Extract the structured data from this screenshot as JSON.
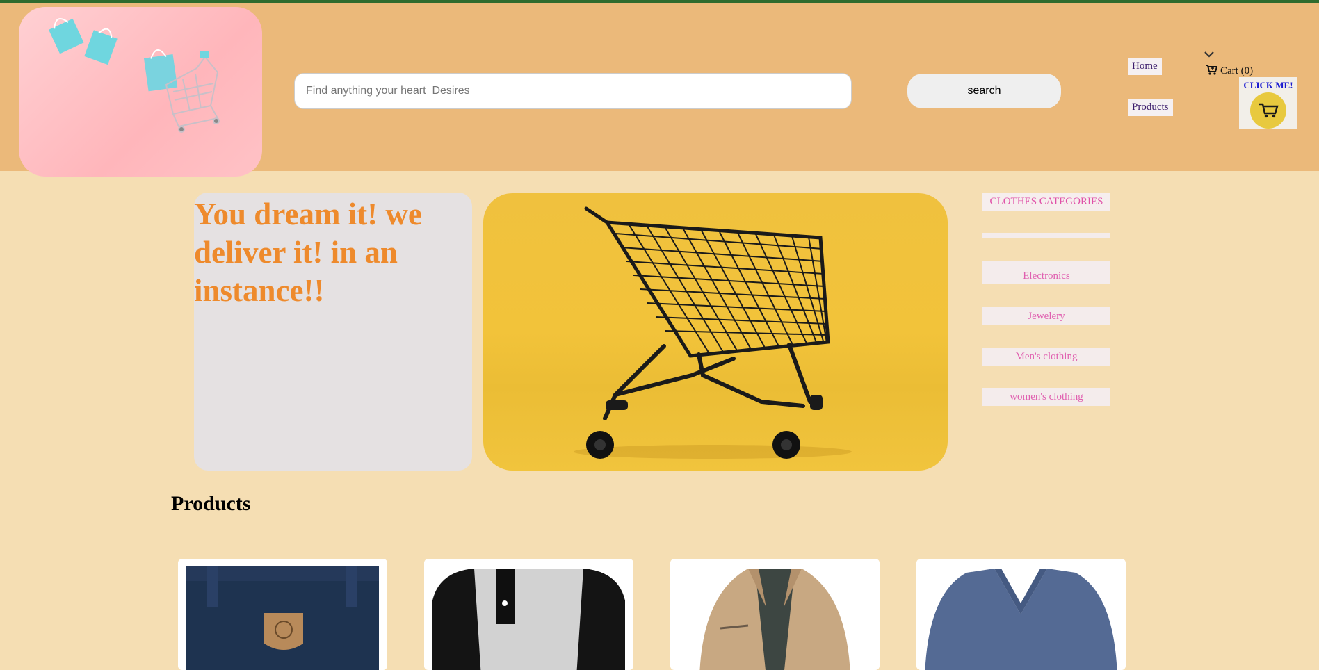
{
  "header": {
    "search_placeholder": "Find anything your heart  Desires",
    "search_button": "search",
    "nav": {
      "home": "Home",
      "products": "Products"
    },
    "cart_label": "Cart (0)",
    "click_me": "CLICK ME!"
  },
  "hero": {
    "tagline": "You dream it! we deliver it! in an instance!!"
  },
  "categories": {
    "title": "CLOTHES CATEGORIES",
    "items": [
      "Electronics",
      "Jewelery",
      "Men's clothing",
      "women's clothing"
    ]
  },
  "products": {
    "heading": "Products",
    "items": [
      {
        "name": "backpack",
        "color": "#1e3350"
      },
      {
        "name": "raglan-shirt",
        "color": "#cfcfcf"
      },
      {
        "name": "jacket",
        "color": "#c8a882"
      },
      {
        "name": "v-neck-shirt",
        "color": "#546a94"
      }
    ]
  },
  "colors": {
    "header_bg": "#ebb97a",
    "page_bg": "#f5deb3",
    "top_bar": "#2e6b2e",
    "tagline": "#ee8a2c",
    "category_text": "#e060b0"
  }
}
